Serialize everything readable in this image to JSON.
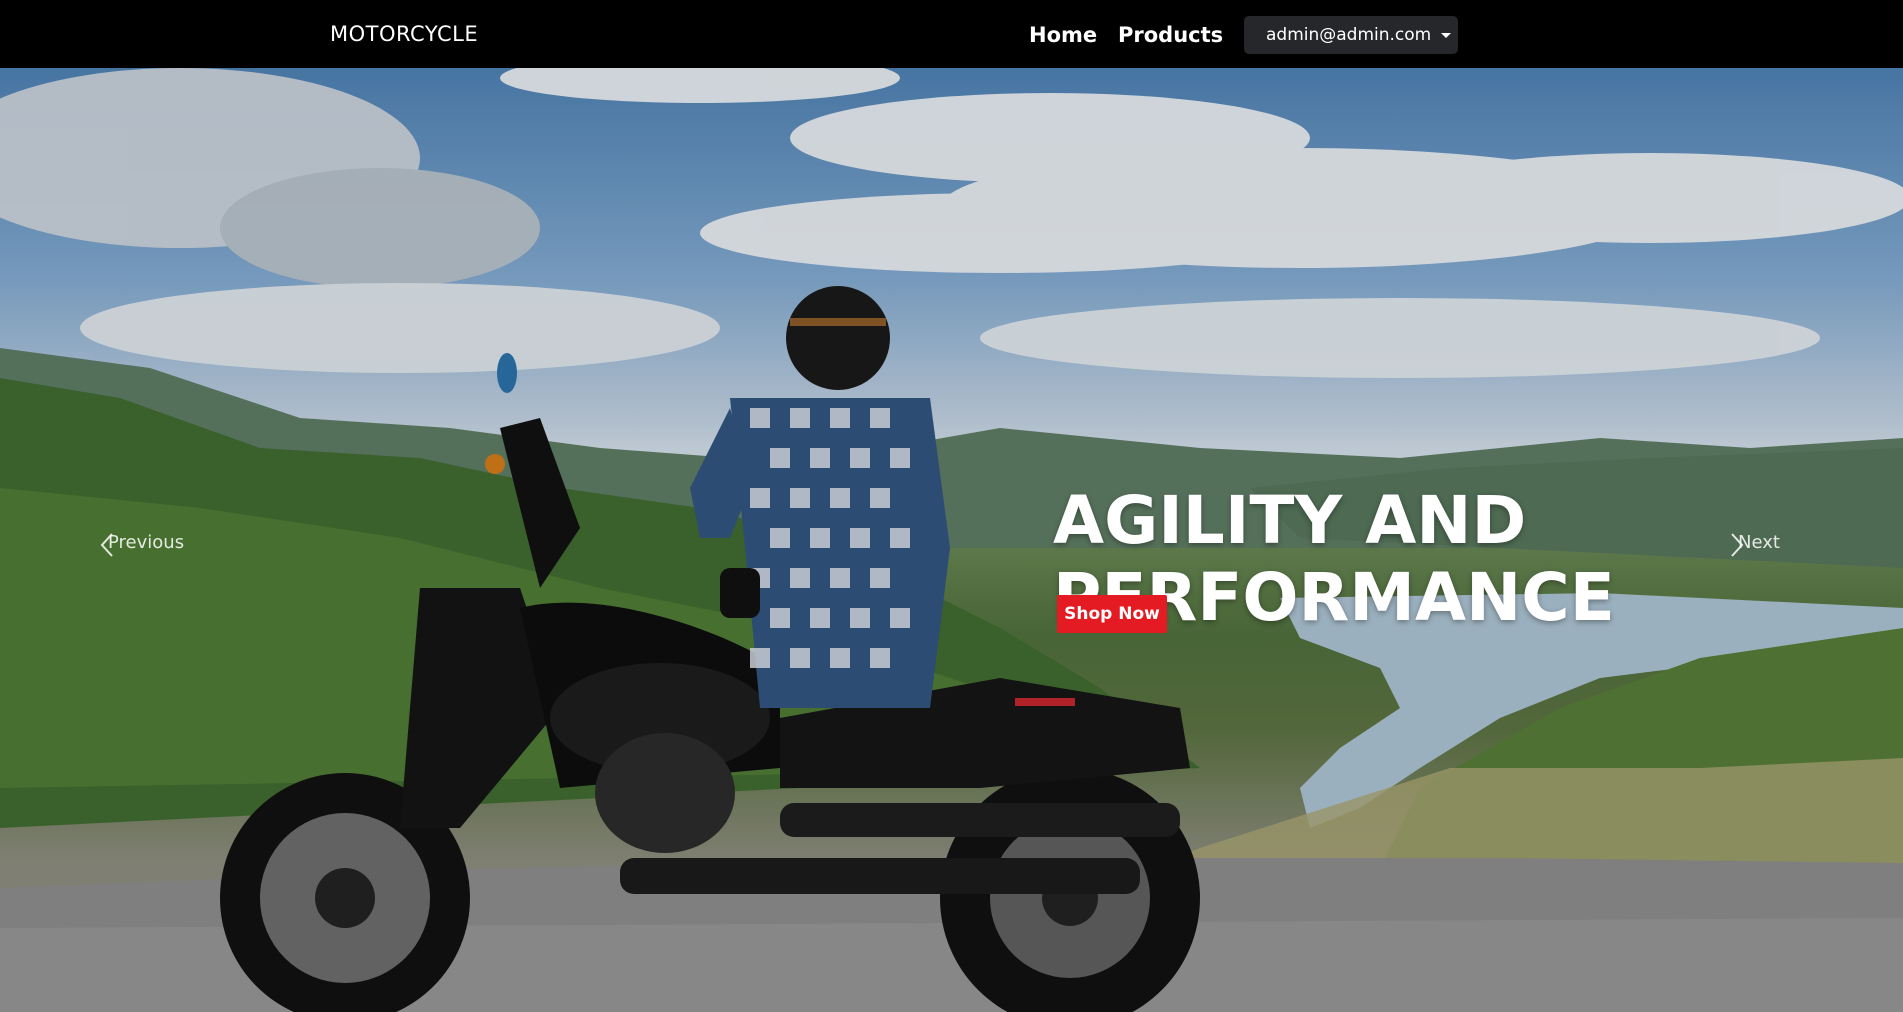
{
  "navbar": {
    "brand": "MOTORCYCLE",
    "links": [
      {
        "label": "Home"
      },
      {
        "label": "Products"
      }
    ],
    "user_menu": {
      "label": "admin@admin.com"
    }
  },
  "carousel": {
    "headline_line1": "AGILITY AND",
    "headline_line2": "PERFORMANCE",
    "cta_label": "Shop Now",
    "prev_label": "Previous",
    "next_label": "Next"
  },
  "colors": {
    "navbar_bg": "#000000",
    "cta_bg": "#e41b23",
    "dropdown_bg": "#25272b"
  }
}
